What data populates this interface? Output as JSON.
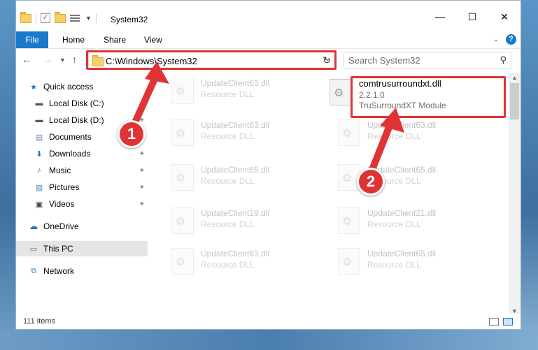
{
  "window": {
    "title": "System32",
    "controls": {
      "minimize": "—",
      "maximize": "☐",
      "close": "✕"
    }
  },
  "ribbon": {
    "tabs": [
      "File",
      "Home",
      "Share",
      "View"
    ]
  },
  "address": {
    "path": "C:\\Windows\\System32",
    "search_placeholder": "Search System32"
  },
  "sidebar": {
    "items": [
      {
        "label": "Quick access",
        "icon": "star-icon"
      },
      {
        "label": "Local Disk (C:)",
        "icon": "drive-icon"
      },
      {
        "label": "Local Disk (D:)",
        "icon": "drive-icon"
      },
      {
        "label": "Documents",
        "icon": "documents-icon"
      },
      {
        "label": "Downloads",
        "icon": "download-icon"
      },
      {
        "label": "Music",
        "icon": "music-icon"
      },
      {
        "label": "Pictures",
        "icon": "pictures-icon"
      },
      {
        "label": "Videos",
        "icon": "videos-icon"
      },
      {
        "label": "OneDrive",
        "icon": "cloud-icon"
      },
      {
        "label": "This PC",
        "icon": "computer-icon"
      },
      {
        "label": "Network",
        "icon": "network-icon"
      }
    ]
  },
  "files": [
    {
      "name": "UpdateClient63.dll",
      "type": "Resource DLL"
    },
    {
      "name": "comtrusurroundxt.dll",
      "version": "2.2.1.0",
      "type": "TruSurroundXT Module"
    },
    {
      "name": "UpdateClient63.dll",
      "type": "Resource DLL"
    },
    {
      "name": "UpdateClient63.dll",
      "type": "Resource DLL"
    },
    {
      "name": "UpdateClient65.dll",
      "type": "Resource DLL"
    },
    {
      "name": "UpdateClient65.dll",
      "type": "Resource DLL"
    },
    {
      "name": "UpdateClient19.dll",
      "type": "Resource DLL"
    },
    {
      "name": "UpdateClient21.dll",
      "type": "Resource DLL"
    },
    {
      "name": "UpdateClient63.dll",
      "type": "Resource DLL"
    },
    {
      "name": "UpdateClient65.dll",
      "type": "Resource DLL"
    }
  ],
  "status": {
    "items": "111 items"
  },
  "annotations": {
    "step1": "1",
    "step2": "2"
  },
  "colors": {
    "accent": "#1979ca",
    "highlight": "#e03434"
  }
}
